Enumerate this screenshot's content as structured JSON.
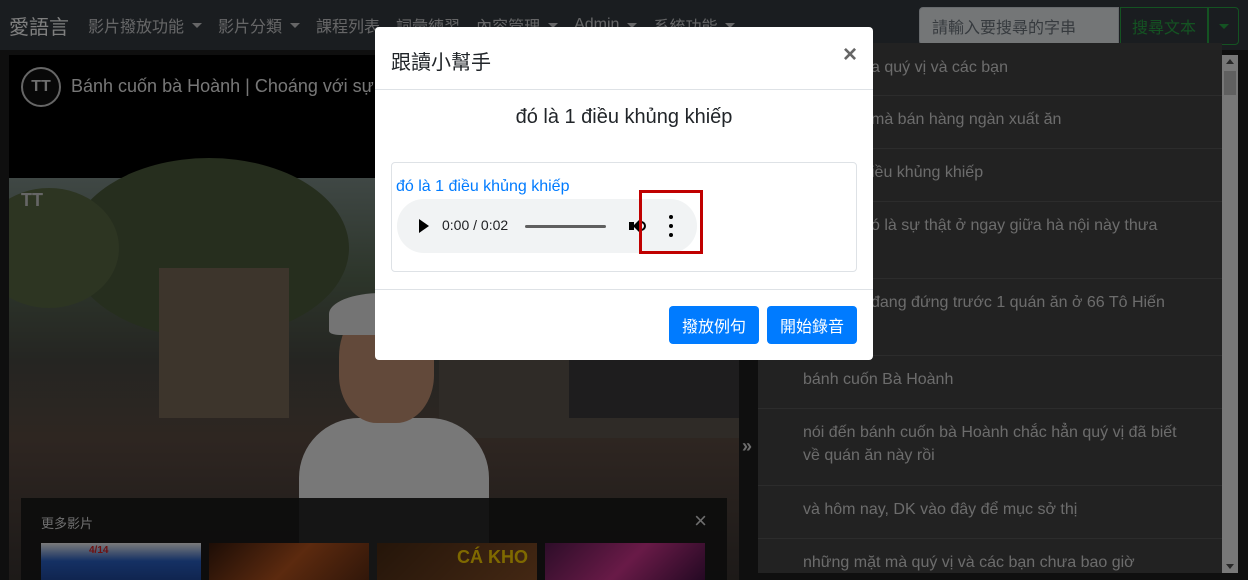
{
  "navbar": {
    "brand": "愛語言",
    "items": [
      {
        "label": "影片撥放功能",
        "dropdown": true
      },
      {
        "label": "影片分類",
        "dropdown": true
      },
      {
        "label": "課程列表",
        "dropdown": false
      },
      {
        "label": "詞彙練習",
        "dropdown": false
      },
      {
        "label": "內容管理",
        "dropdown": true
      },
      {
        "label": "Admin",
        "dropdown": true
      },
      {
        "label": "系統功能",
        "dropdown": true
      }
    ],
    "search_placeholder": "請輸入要搜尋的字串",
    "search_button": "搜尋文本"
  },
  "video": {
    "title": "Bánh cuốn bà Hoành | Choáng với sự v",
    "more_videos_title": "更多影片",
    "close_symbol": "×",
    "thumbnails": [
      {
        "caption": "4/14"
      },
      {
        "caption": ""
      },
      {
        "caption": "CÁ KHO"
      },
      {
        "caption": ""
      }
    ]
  },
  "transcript": {
    "lines": [
      "a quý vị và các bạn",
      "mà bán hàng ngàn xuất ăn",
      "iều khủng khiếp",
      "ó là sự thật ở ngay giữa hà nội này thưa",
      "đang đứng trước 1 quán ăn ở 66 Tô Hiến",
      "bánh cuốn Bà Hoành",
      "nói đến bánh cuốn bà Hoành chắc hẳn quý vị đã biết về quán ăn này rồi",
      "và hôm nay, DK vào đây để mục sở thị",
      "những mặt mà quý vị và các bạn chưa bao giờ"
    ]
  },
  "modal": {
    "title": "跟讀小幫手",
    "close_symbol": "×",
    "sentence": "đó là 1 điều khủng khiếp",
    "audio_label": "đó là 1 điều khủng khiếp",
    "time_display": "0:00 / 0:02",
    "play_example_button": "撥放例句",
    "start_recording_button": "開始錄音"
  },
  "colors": {
    "primary": "#007bff",
    "success": "#28a745",
    "navbar": "#343a40",
    "highlight": "#c00000"
  }
}
